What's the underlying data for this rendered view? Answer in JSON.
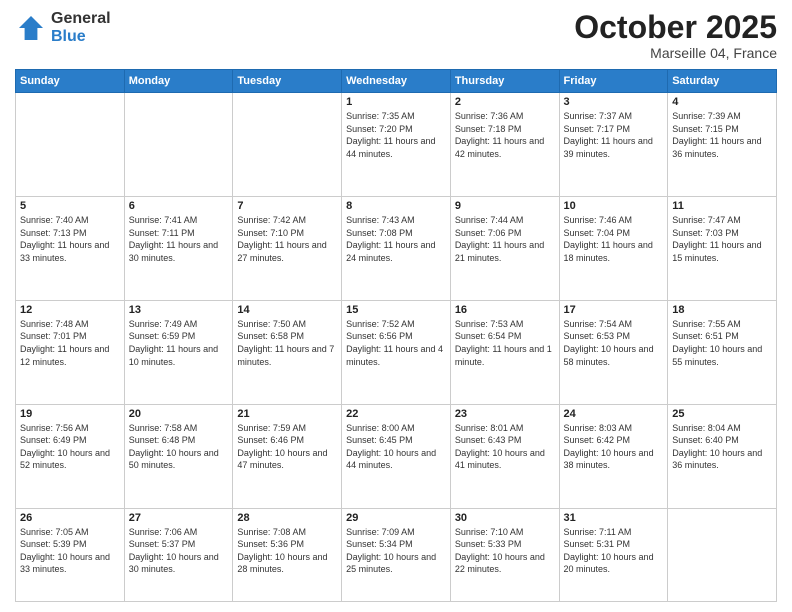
{
  "logo": {
    "general": "General",
    "blue": "Blue"
  },
  "header": {
    "month": "October 2025",
    "location": "Marseille 04, France"
  },
  "weekdays": [
    "Sunday",
    "Monday",
    "Tuesday",
    "Wednesday",
    "Thursday",
    "Friday",
    "Saturday"
  ],
  "weeks": [
    [
      {
        "day": "",
        "info": ""
      },
      {
        "day": "",
        "info": ""
      },
      {
        "day": "",
        "info": ""
      },
      {
        "day": "1",
        "info": "Sunrise: 7:35 AM\nSunset: 7:20 PM\nDaylight: 11 hours\nand 44 minutes."
      },
      {
        "day": "2",
        "info": "Sunrise: 7:36 AM\nSunset: 7:18 PM\nDaylight: 11 hours\nand 42 minutes."
      },
      {
        "day": "3",
        "info": "Sunrise: 7:37 AM\nSunset: 7:17 PM\nDaylight: 11 hours\nand 39 minutes."
      },
      {
        "day": "4",
        "info": "Sunrise: 7:39 AM\nSunset: 7:15 PM\nDaylight: 11 hours\nand 36 minutes."
      }
    ],
    [
      {
        "day": "5",
        "info": "Sunrise: 7:40 AM\nSunset: 7:13 PM\nDaylight: 11 hours\nand 33 minutes."
      },
      {
        "day": "6",
        "info": "Sunrise: 7:41 AM\nSunset: 7:11 PM\nDaylight: 11 hours\nand 30 minutes."
      },
      {
        "day": "7",
        "info": "Sunrise: 7:42 AM\nSunset: 7:10 PM\nDaylight: 11 hours\nand 27 minutes."
      },
      {
        "day": "8",
        "info": "Sunrise: 7:43 AM\nSunset: 7:08 PM\nDaylight: 11 hours\nand 24 minutes."
      },
      {
        "day": "9",
        "info": "Sunrise: 7:44 AM\nSunset: 7:06 PM\nDaylight: 11 hours\nand 21 minutes."
      },
      {
        "day": "10",
        "info": "Sunrise: 7:46 AM\nSunset: 7:04 PM\nDaylight: 11 hours\nand 18 minutes."
      },
      {
        "day": "11",
        "info": "Sunrise: 7:47 AM\nSunset: 7:03 PM\nDaylight: 11 hours\nand 15 minutes."
      }
    ],
    [
      {
        "day": "12",
        "info": "Sunrise: 7:48 AM\nSunset: 7:01 PM\nDaylight: 11 hours\nand 12 minutes."
      },
      {
        "day": "13",
        "info": "Sunrise: 7:49 AM\nSunset: 6:59 PM\nDaylight: 11 hours\nand 10 minutes."
      },
      {
        "day": "14",
        "info": "Sunrise: 7:50 AM\nSunset: 6:58 PM\nDaylight: 11 hours\nand 7 minutes."
      },
      {
        "day": "15",
        "info": "Sunrise: 7:52 AM\nSunset: 6:56 PM\nDaylight: 11 hours\nand 4 minutes."
      },
      {
        "day": "16",
        "info": "Sunrise: 7:53 AM\nSunset: 6:54 PM\nDaylight: 11 hours\nand 1 minute."
      },
      {
        "day": "17",
        "info": "Sunrise: 7:54 AM\nSunset: 6:53 PM\nDaylight: 10 hours\nand 58 minutes."
      },
      {
        "day": "18",
        "info": "Sunrise: 7:55 AM\nSunset: 6:51 PM\nDaylight: 10 hours\nand 55 minutes."
      }
    ],
    [
      {
        "day": "19",
        "info": "Sunrise: 7:56 AM\nSunset: 6:49 PM\nDaylight: 10 hours\nand 52 minutes."
      },
      {
        "day": "20",
        "info": "Sunrise: 7:58 AM\nSunset: 6:48 PM\nDaylight: 10 hours\nand 50 minutes."
      },
      {
        "day": "21",
        "info": "Sunrise: 7:59 AM\nSunset: 6:46 PM\nDaylight: 10 hours\nand 47 minutes."
      },
      {
        "day": "22",
        "info": "Sunrise: 8:00 AM\nSunset: 6:45 PM\nDaylight: 10 hours\nand 44 minutes."
      },
      {
        "day": "23",
        "info": "Sunrise: 8:01 AM\nSunset: 6:43 PM\nDaylight: 10 hours\nand 41 minutes."
      },
      {
        "day": "24",
        "info": "Sunrise: 8:03 AM\nSunset: 6:42 PM\nDaylight: 10 hours\nand 38 minutes."
      },
      {
        "day": "25",
        "info": "Sunrise: 8:04 AM\nSunset: 6:40 PM\nDaylight: 10 hours\nand 36 minutes."
      }
    ],
    [
      {
        "day": "26",
        "info": "Sunrise: 7:05 AM\nSunset: 5:39 PM\nDaylight: 10 hours\nand 33 minutes."
      },
      {
        "day": "27",
        "info": "Sunrise: 7:06 AM\nSunset: 5:37 PM\nDaylight: 10 hours\nand 30 minutes."
      },
      {
        "day": "28",
        "info": "Sunrise: 7:08 AM\nSunset: 5:36 PM\nDaylight: 10 hours\nand 28 minutes."
      },
      {
        "day": "29",
        "info": "Sunrise: 7:09 AM\nSunset: 5:34 PM\nDaylight: 10 hours\nand 25 minutes."
      },
      {
        "day": "30",
        "info": "Sunrise: 7:10 AM\nSunset: 5:33 PM\nDaylight: 10 hours\nand 22 minutes."
      },
      {
        "day": "31",
        "info": "Sunrise: 7:11 AM\nSunset: 5:31 PM\nDaylight: 10 hours\nand 20 minutes."
      },
      {
        "day": "",
        "info": ""
      }
    ]
  ]
}
